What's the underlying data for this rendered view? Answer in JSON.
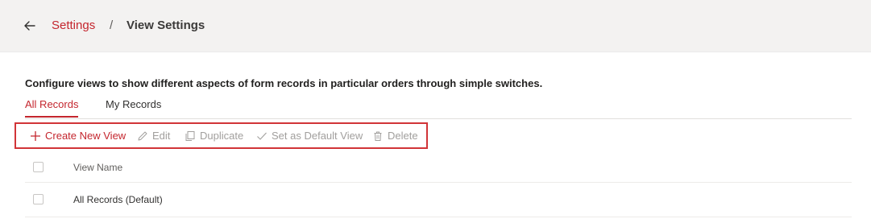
{
  "header": {
    "back_icon": "arrow-left-icon",
    "breadcrumb": {
      "parent": "Settings",
      "separator": "/",
      "current": "View Settings"
    }
  },
  "description": "Configure views to show different aspects of form records in particular orders through simple switches.",
  "tabs": [
    {
      "label": "All Records",
      "active": true
    },
    {
      "label": "My Records",
      "active": false
    }
  ],
  "toolbar": {
    "create": {
      "label": "Create New View",
      "icon": "plus-icon",
      "enabled": true
    },
    "edit": {
      "label": "Edit",
      "icon": "pencil-icon",
      "enabled": false
    },
    "duplicate": {
      "label": "Duplicate",
      "icon": "copy-icon",
      "enabled": false
    },
    "set_default": {
      "label": "Set as Default View",
      "icon": "checkmark-icon",
      "enabled": false
    },
    "delete": {
      "label": "Delete",
      "icon": "trash-icon",
      "enabled": false
    }
  },
  "grid": {
    "columns": [
      {
        "label": "View Name"
      }
    ],
    "rows": [
      {
        "name": "All Records (Default)"
      }
    ]
  },
  "colors": {
    "accent": "#c4262e",
    "highlight_border": "#d13438",
    "header_bg": "#f3f2f1",
    "disabled_text": "#a19f9d"
  }
}
